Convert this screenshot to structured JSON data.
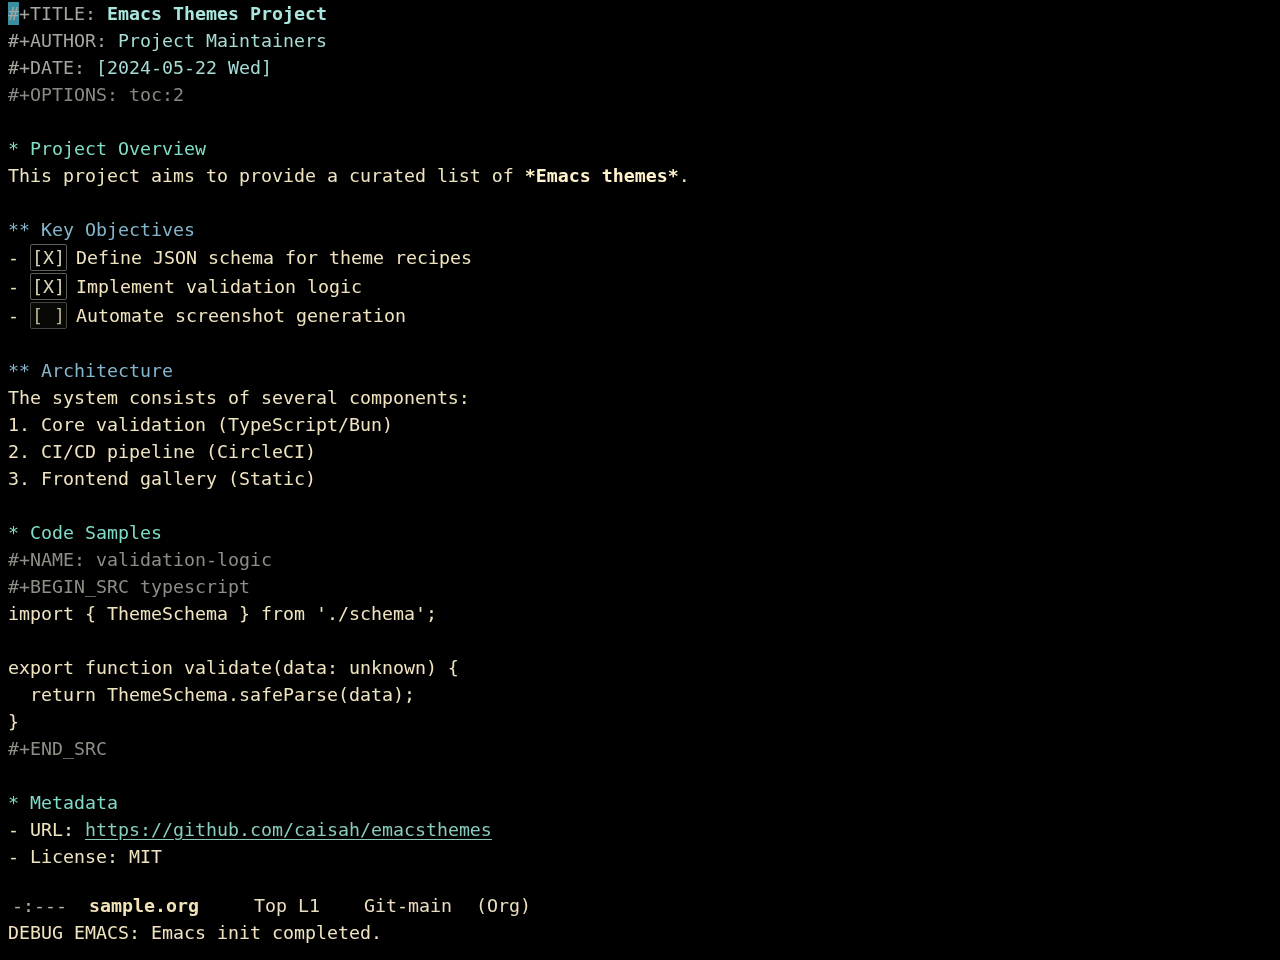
{
  "buffer": {
    "keywords": [
      {
        "kind": "title",
        "key": "#+TITLE:",
        "value": "Emacs Themes Project",
        "cursor": true
      },
      {
        "kind": "author",
        "key": "#+AUTHOR:",
        "value": "Project Maintainers"
      },
      {
        "kind": "date",
        "key": "#+DATE:",
        "value": "[2024-05-22 Wed]"
      },
      {
        "kind": "option",
        "key": "#+OPTIONS:",
        "value": "toc:2"
      }
    ],
    "sections": [
      {
        "heading": "* Project Overview",
        "body": [
          {
            "kind": "paragraph",
            "segments": [
              {
                "text": "This project aims to provide a curated list of ",
                "strong": false
              },
              {
                "text": "*Emacs themes*",
                "strong": true
              },
              {
                "text": ".",
                "strong": false
              }
            ]
          }
        ],
        "children": [
          {
            "heading": "** Key Objectives",
            "body": [
              {
                "kind": "checkbox",
                "bullet": "-",
                "box": "[X]",
                "checked": true,
                "text": "Define JSON schema for theme recipes"
              },
              {
                "kind": "checkbox",
                "bullet": "-",
                "box": "[X]",
                "checked": true,
                "text": "Implement validation logic"
              },
              {
                "kind": "checkbox",
                "bullet": "-",
                "box": "[ ]",
                "checked": false,
                "text": "Automate screenshot generation"
              }
            ]
          },
          {
            "heading": "** Architecture",
            "body": [
              {
                "kind": "plain",
                "text": "The system consists of several components:"
              },
              {
                "kind": "numbered",
                "text": "1. Core validation (TypeScript/Bun)"
              },
              {
                "kind": "numbered",
                "text": "2. CI/CD pipeline (CircleCI)"
              },
              {
                "kind": "numbered",
                "text": "3. Frontend gallery (Static)"
              }
            ]
          }
        ]
      },
      {
        "heading": "* Code Samples",
        "body": [
          {
            "kind": "meta",
            "text": "#+NAME: validation-logic"
          },
          {
            "kind": "meta",
            "text": "#+BEGIN_SRC typescript"
          },
          {
            "kind": "code",
            "text": "import { ThemeSchema } from './schema';\n\nexport function validate(data: unknown) {\n  return ThemeSchema.safeParse(data);\n}"
          },
          {
            "kind": "meta",
            "text": "#+END_SRC"
          }
        ]
      },
      {
        "heading": "* Metadata",
        "body": [
          {
            "kind": "link_item",
            "text": "- URL:",
            "link": "https://github.com/caisah/emacsthemes"
          },
          {
            "kind": "plain",
            "text": "- License: MIT"
          }
        ]
      }
    ]
  },
  "mode_line": {
    "fields": [
      {
        "kind": "status",
        "text": "-:---"
      },
      {
        "kind": "buffer_name",
        "text": "sample.org"
      },
      {
        "kind": "position",
        "text": "Top L1"
      },
      {
        "kind": "vc",
        "text": "Git-main"
      },
      {
        "kind": "mode",
        "text": "(Org)"
      }
    ]
  },
  "echo_area": {
    "message": "DEBUG EMACS: Emacs init completed."
  }
}
